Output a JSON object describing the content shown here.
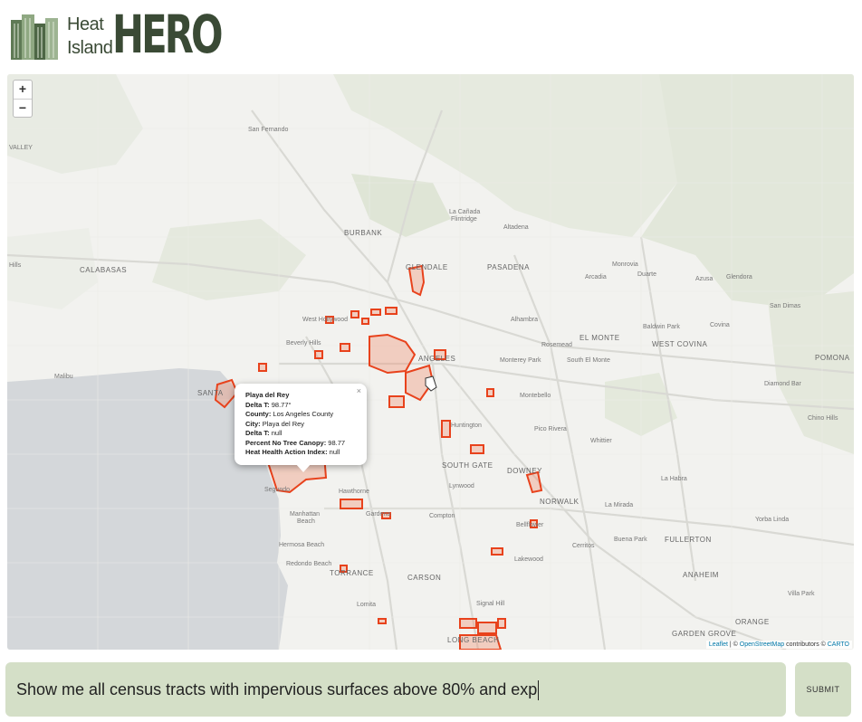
{
  "brand": {
    "line1": "Heat",
    "line2": "Island",
    "title": "HERO"
  },
  "map": {
    "zoom_in": "+",
    "zoom_out": "−",
    "labels": {
      "valley": "VALLEY",
      "san_fernando": "San Fernando",
      "burbank": "BURBANK",
      "la_canada": "La Cañada",
      "flintridge": "Flintridge",
      "altadena": "Altadena",
      "hills": "Hills",
      "calabasas": "CALABASAS",
      "glendale": "GLENDALE",
      "pasadena": "PASADENA",
      "monrovia": "Monrovia",
      "arcadia": "Arcadia",
      "duarte": "Duarte",
      "azusa": "Azusa",
      "glendora": "Glendora",
      "san_dimas": "San Dimas",
      "west_hollywood": "West Hollywood",
      "alhambra": "Alhambra",
      "baldwin_park": "Baldwin Park",
      "covina": "Covina",
      "beverly_hills": "Beverly Hills",
      "el_monte": "EL MONTE",
      "west_covina": "WEST COVINA",
      "rosemead": "Rosemead",
      "angeles": "ANGELES",
      "monterey_park": "Monterey Park",
      "south_el_monte": "South El Monte",
      "pomona": "POMONA",
      "malibu": "Malibu",
      "santa": "SANTA",
      "diamond_bar": "Diamond Bar",
      "montebello": "Montebello",
      "huntington": "Huntington",
      "pico_rivera": "Pico Rivera",
      "chino_hills": "Chino Hills",
      "whittier": "Whittier",
      "south_gate": "SOUTH GATE",
      "downey": "DOWNEY",
      "lynwood": "Lynwood",
      "la_habra": "La Habra",
      "segundo": "Segundo",
      "hawthorne": "Hawthorne",
      "norwalk": "NORWALK",
      "la_mirada": "La Mirada",
      "manhattan": "Manhattan",
      "beach": "Beach",
      "gardena": "Gardena",
      "compton": "Compton",
      "bellflower": "Bellflower",
      "yorba_linda": "Yorba Linda",
      "hermosa_beach": "Hermosa Beach",
      "buena_park": "Buena Park",
      "fullerton": "FULLERTON",
      "cerritos": "Cerritos",
      "redondo_beach": "Redondo Beach",
      "torrance": "TORRANCE",
      "carson": "CARSON",
      "lakewood": "Lakewood",
      "anaheim": "ANAHEIM",
      "lomita": "Lomita",
      "signal_hill": "Signal Hill",
      "villa_park": "Villa Park",
      "orange": "ORANGE",
      "garden_grove": "GARDEN GROVE",
      "long_beach": "LONG BEACH"
    },
    "popup": {
      "close": "×",
      "title": "Playa del Rey",
      "rows": [
        {
          "k": "Delta T:",
          "v": " 98.77°"
        },
        {
          "k": "County:",
          "v": " Los Angeles County"
        },
        {
          "k": "City:",
          "v": " Playa del Rey"
        },
        {
          "k": "Delta T:",
          "v": " null"
        },
        {
          "k": "Percent No Tree Canopy:",
          "v": " 98.77"
        },
        {
          "k": "Heat Health Action Index:",
          "v": " null"
        }
      ]
    },
    "attribution": {
      "leaflet": "Leaflet",
      "sep": " | © ",
      "osm": "OpenStreetMap",
      "contrib": " contributors © ",
      "carto": "CARTO"
    },
    "colors": {
      "tract_stroke": "#e8421c",
      "tract_fill": "#f28a6a",
      "water": "#d4d7da",
      "land": "#f2f2ef",
      "park": "#e3e8dc"
    }
  },
  "query": {
    "value": "Show me all census tracts with impervious surfaces above 80% and exp"
  },
  "submit": {
    "label": "SUBMIT"
  },
  "accent": "#d4dfc7"
}
